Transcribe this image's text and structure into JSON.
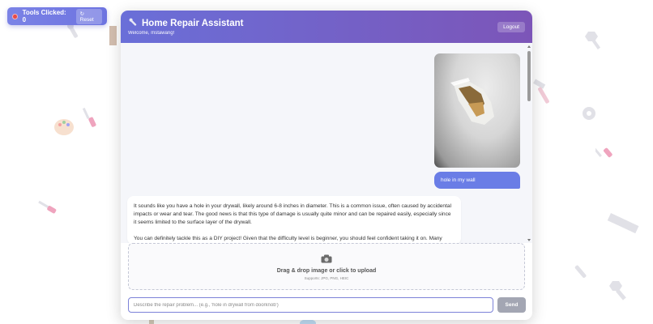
{
  "counter": {
    "label": "Tools Clicked: 0",
    "reset_label": "↻ Reset",
    "target_icon": "target-icon"
  },
  "header": {
    "icon": "wrench-icon",
    "title": "Home Repair Assistant",
    "welcome": "Welcome, mstawang!",
    "logout_label": "Logout"
  },
  "chat": {
    "user_message": "hole in my wall",
    "bot_paragraphs": [
      "It sounds like you have a hole in your drywall, likely around 6-8 inches in diameter. This is a common issue, often caused by accidental impacts or wear and tear. The good news is that this type of damage is usually quite minor and can be repaired easily, especially since it seems limited to the surface layer of the drywall.",
      "You can definitely tackle this as a DIY project! Given that the difficulty level is beginner, you should feel confident taking it on. Many"
    ]
  },
  "upload": {
    "icon": "camera-icon",
    "label": "Drag & drop image or click to upload",
    "hint": "Supports: JPG, PNG, HEIC"
  },
  "composer": {
    "placeholder": "Describe the repair problem... (e.g., 'hole in drywall from doorknob')",
    "send_label": "Send"
  },
  "colors": {
    "header_start": "#6a6fd8",
    "header_end": "#7c55b8",
    "user_bubble": "#6a7de6",
    "send_disabled": "#a3a6b3"
  }
}
